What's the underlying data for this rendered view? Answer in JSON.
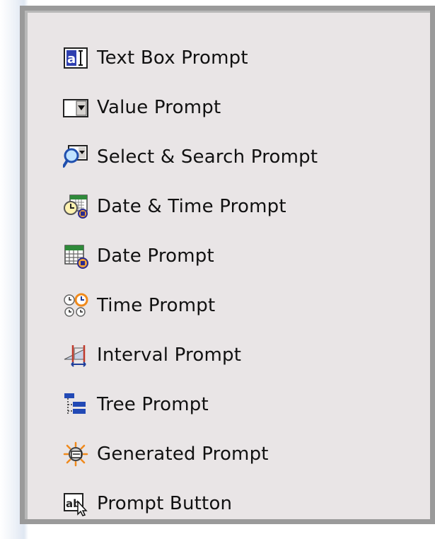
{
  "prompt_palette": {
    "items": [
      {
        "label": "Text Box Prompt",
        "icon": "text-box-prompt-icon"
      },
      {
        "label": "Value Prompt",
        "icon": "value-prompt-icon"
      },
      {
        "label": "Select & Search Prompt",
        "icon": "select-search-prompt-icon"
      },
      {
        "label": "Date & Time Prompt",
        "icon": "date-time-prompt-icon"
      },
      {
        "label": "Date Prompt",
        "icon": "date-prompt-icon"
      },
      {
        "label": "Time Prompt",
        "icon": "time-prompt-icon"
      },
      {
        "label": "Interval Prompt",
        "icon": "interval-prompt-icon"
      },
      {
        "label": "Tree Prompt",
        "icon": "tree-prompt-icon"
      },
      {
        "label": "Generated Prompt",
        "icon": "generated-prompt-icon"
      },
      {
        "label": "Prompt Button",
        "icon": "prompt-button-icon"
      }
    ]
  }
}
